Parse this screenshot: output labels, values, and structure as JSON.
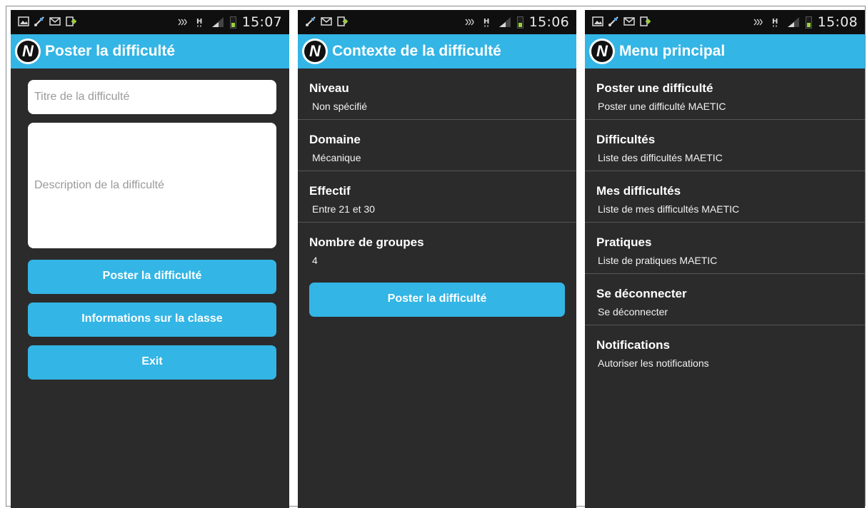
{
  "screens": [
    {
      "time": "15:07",
      "title": "Poster la difficulté",
      "logo_letter": "N",
      "title_placeholder": "Titre de la difficulté",
      "description_placeholder": "Description de la difficulté",
      "buttons": [
        "Poster la difficulté",
        "Informations sur la classe",
        "Exit"
      ]
    },
    {
      "time": "15:06",
      "title": "Contexte de la difficulté",
      "logo_letter": "N",
      "items": [
        {
          "title": "Niveau",
          "value": "Non spécifié"
        },
        {
          "title": "Domaine",
          "value": "Mécanique"
        },
        {
          "title": "Effectif",
          "value": "Entre 21 et 30"
        },
        {
          "title": "Nombre de groupes",
          "value": "4"
        }
      ],
      "button": "Poster la difficulté"
    },
    {
      "time": "15:08",
      "title": "Menu principal",
      "logo_letter": "N",
      "items": [
        {
          "title": "Poster une difficulté",
          "subtitle": "Poster une difficulté MAETIC"
        },
        {
          "title": "Difficultés",
          "subtitle": "Liste des difficultés MAETIC"
        },
        {
          "title": "Mes difficultés",
          "subtitle": "Liste de mes difficultés MAETIC"
        },
        {
          "title": "Pratiques",
          "subtitle": "Liste de pratiques MAETIC"
        },
        {
          "title": "Se déconnecter",
          "subtitle": "Se déconnecter"
        },
        {
          "title": "Notifications",
          "subtitle": "Autoriser les notifications"
        }
      ]
    }
  ],
  "status_icons": {
    "screen1_left": [
      "gallery-icon",
      "usb-icon",
      "gmail-icon",
      "download-icon"
    ],
    "screen2_left": [
      "usb-icon",
      "gmail-icon",
      "download-icon"
    ],
    "screen3_left": [
      "gallery-icon",
      "usb-icon",
      "gmail-icon",
      "download-icon"
    ],
    "right": [
      "nfc-icon",
      "network-h-icon",
      "signal-icon",
      "battery-icon"
    ]
  },
  "colors": {
    "accent": "#33b5e5",
    "background": "#2b2b2b",
    "statusbar": "#0f0f0f",
    "divider": "#555555"
  }
}
